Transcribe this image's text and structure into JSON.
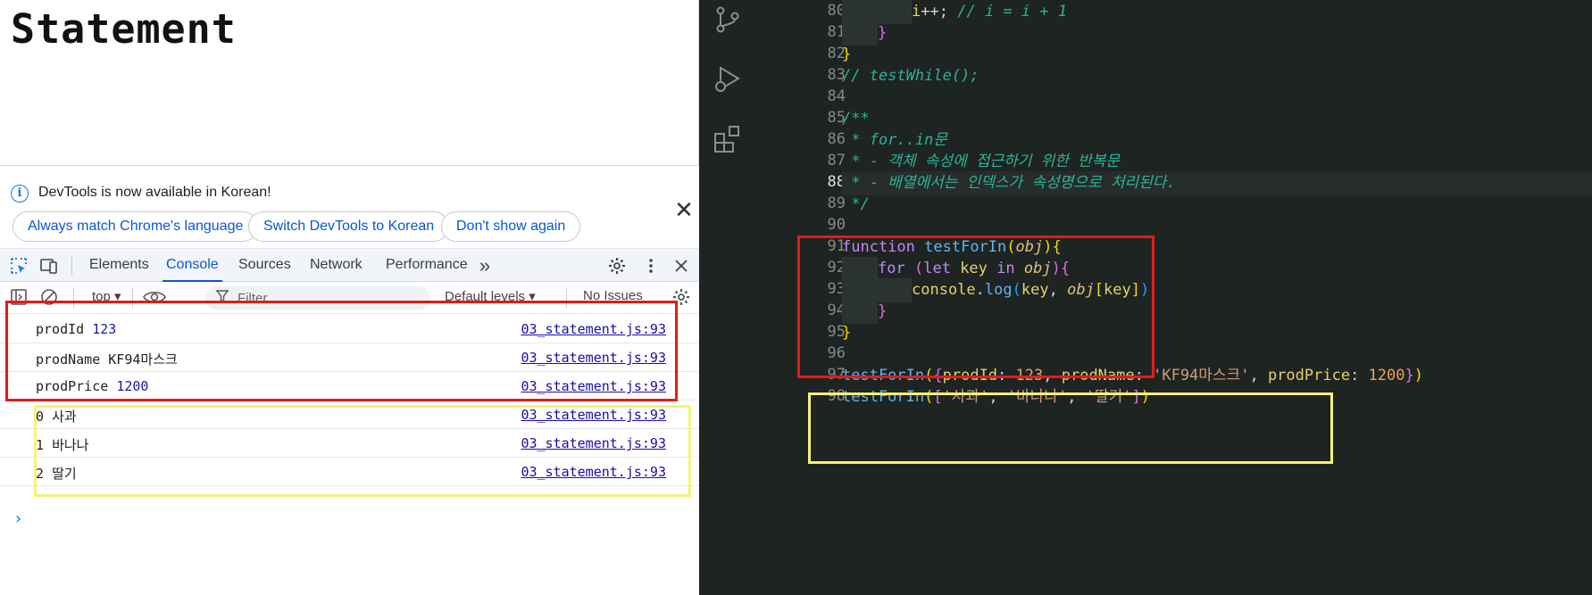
{
  "page": {
    "heading": "Statement"
  },
  "devtools": {
    "infobar": {
      "message": "DevTools is now available in Korean!",
      "buttons": [
        "Always match Chrome's language",
        "Switch DevTools to Korean",
        "Don't show again"
      ],
      "close_glyph": "✕"
    },
    "tabs": [
      "Elements",
      "Console",
      "Sources",
      "Network",
      "Performance"
    ],
    "active_tab": "Console",
    "more_tabs_glyph": "»",
    "toolbar": {
      "context": "top ▾",
      "filter_placeholder": "Filter",
      "levels": "Default levels ▾",
      "issues": "No Issues"
    },
    "console": {
      "rows": [
        {
          "key": "prodId",
          "value": "123",
          "numeric": true,
          "source": "03_statement.js:93"
        },
        {
          "key": "prodName",
          "value": "KF94마스크",
          "numeric": false,
          "source": "03_statement.js:93"
        },
        {
          "key": "prodPrice",
          "value": "1200",
          "numeric": true,
          "source": "03_statement.js:93"
        },
        {
          "key": "0",
          "value": "사과",
          "numeric": false,
          "source": "03_statement.js:93"
        },
        {
          "key": "1",
          "value": "바나나",
          "numeric": false,
          "source": "03_statement.js:93"
        },
        {
          "key": "2",
          "value": "딸기",
          "numeric": false,
          "source": "03_statement.js:93"
        }
      ],
      "prompt_glyph": "›"
    }
  },
  "editor": {
    "current_line": 88,
    "line_numbers": [
      80,
      81,
      82,
      83,
      84,
      85,
      86,
      87,
      88,
      89,
      90,
      91,
      92,
      93,
      94,
      95,
      96,
      97,
      98
    ],
    "activity_icons": [
      "source-control-icon",
      "run-debug-icon",
      "extensions-icon"
    ]
  },
  "colors": {
    "annotation_red": "#e21b1b",
    "annotation_yellow": "#f5f27a",
    "devtools_accent": "#0b57d0",
    "editor_bg": "#1e2422"
  }
}
